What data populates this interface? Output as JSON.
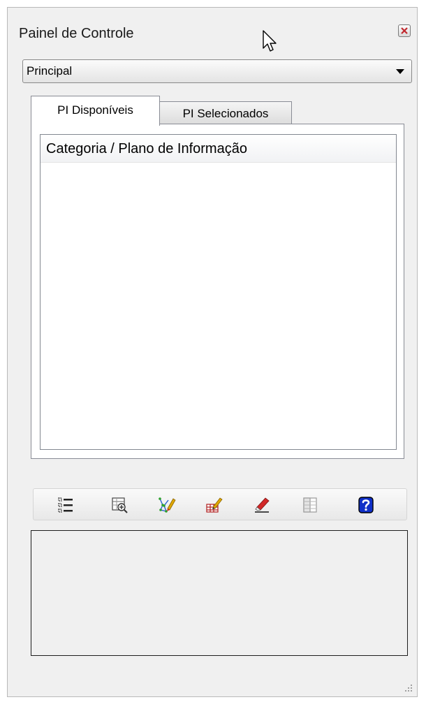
{
  "window": {
    "title": "Painel de Controle"
  },
  "dropdown": {
    "selected": "Principal"
  },
  "tabs": [
    {
      "label": "PI Disponíveis",
      "active": true
    },
    {
      "label": "PI Selecionados",
      "active": false
    }
  ],
  "tree": {
    "column_header": "Categoria / Plano de Informação"
  },
  "toolbar": {
    "icons": [
      "list-icon",
      "zoom-grid-icon",
      "edit-vertices-icon",
      "edit-table-icon",
      "eraser-icon",
      "attribute-table-icon",
      "help-icon"
    ]
  },
  "colors": {
    "window_bg": "#f0f0f0",
    "help_blue": "#1030c8",
    "pencil_red": "#d22828",
    "close_x": "#c0282e"
  }
}
